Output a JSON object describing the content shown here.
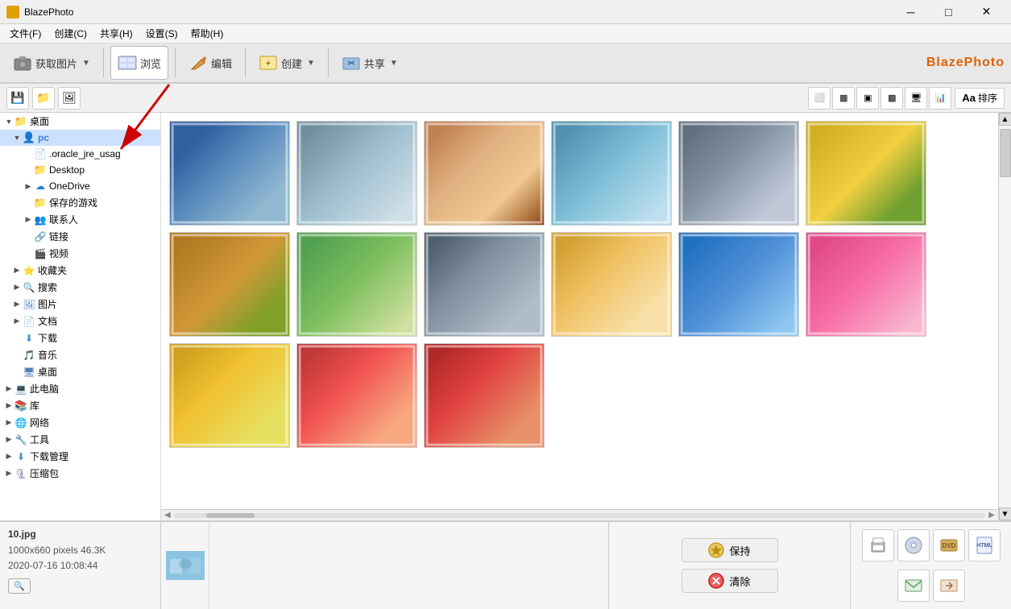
{
  "titleBar": {
    "appName": "BlazePhoto",
    "icon": "🔥",
    "minBtn": "─",
    "maxBtn": "□",
    "closeBtn": "✕"
  },
  "menuBar": {
    "items": [
      "文件(F)",
      "创建(C)",
      "共享(H)",
      "设置(S)",
      "帮助(H)"
    ]
  },
  "toolbar": {
    "groups": [
      {
        "id": "get",
        "icon": "📷",
        "label": "获取图片",
        "hasArrow": true
      },
      {
        "id": "browse",
        "icon": "🖼",
        "label": "浏览",
        "hasArrow": false,
        "active": true
      },
      {
        "id": "edit",
        "icon": "✏️",
        "label": "编辑",
        "hasArrow": false
      },
      {
        "id": "create",
        "icon": "🎨",
        "label": "创建",
        "hasArrow": true
      },
      {
        "id": "share",
        "icon": "📤",
        "label": "共享",
        "hasArrow": true
      }
    ],
    "brand": "BlazePhoto"
  },
  "subToolbar": {
    "buttons": [
      "💾",
      "📁",
      "🖼"
    ],
    "viewButtons": [
      "⬜",
      "▦",
      "▣",
      "▩",
      "🖥",
      "📊"
    ],
    "sortLabel": "排序",
    "textSizeIcon": "Aa"
  },
  "sidebar": {
    "items": [
      {
        "level": 0,
        "toggle": "▼",
        "icon": "folder",
        "label": "桌面",
        "color": "blue"
      },
      {
        "level": 1,
        "toggle": "▼",
        "icon": "folder",
        "label": "pc",
        "color": "blue",
        "selected": true
      },
      {
        "level": 2,
        "toggle": " ",
        "icon": "doc",
        "label": ".oracle_jre_usag",
        "color": "doc"
      },
      {
        "level": 2,
        "toggle": " ",
        "icon": "folder",
        "label": "Desktop",
        "color": "yellow"
      },
      {
        "level": 2,
        "toggle": "▶",
        "icon": "cloud",
        "label": "OneDrive",
        "color": "blue"
      },
      {
        "level": 2,
        "toggle": " ",
        "icon": "game",
        "label": "保存的游戏",
        "color": "yellow"
      },
      {
        "level": 2,
        "toggle": "▶",
        "icon": "contacts",
        "label": "联系人",
        "color": "blue"
      },
      {
        "level": 2,
        "toggle": " ",
        "icon": "link",
        "label": "链接",
        "color": "blue"
      },
      {
        "level": 2,
        "toggle": " ",
        "icon": "video",
        "label": "视频",
        "color": "blue"
      },
      {
        "level": 1,
        "toggle": "▶",
        "icon": "star",
        "label": "收藏夹",
        "color": "yellow"
      },
      {
        "level": 1,
        "toggle": "▶",
        "icon": "search",
        "label": "搜索",
        "color": "blue"
      },
      {
        "level": 1,
        "toggle": "▶",
        "icon": "picture",
        "label": "图片",
        "color": "blue"
      },
      {
        "level": 1,
        "toggle": "▶",
        "icon": "doc",
        "label": "文档",
        "color": "blue"
      },
      {
        "level": 1,
        "toggle": " ",
        "icon": "download",
        "label": "下载",
        "color": "blue"
      },
      {
        "level": 1,
        "toggle": " ",
        "icon": "music",
        "label": "音乐",
        "color": "blue"
      },
      {
        "level": 1,
        "toggle": " ",
        "icon": "desktop",
        "label": "桌面",
        "color": "blue"
      },
      {
        "level": 0,
        "toggle": "▶",
        "icon": "computer",
        "label": "此电脑",
        "color": "blue"
      },
      {
        "level": 0,
        "toggle": "▶",
        "icon": "library",
        "label": "库",
        "color": "blue"
      },
      {
        "level": 0,
        "toggle": "▶",
        "icon": "network",
        "label": "网络",
        "color": "blue"
      },
      {
        "level": 0,
        "toggle": "▶",
        "icon": "tools",
        "label": "工具",
        "color": "blue"
      },
      {
        "level": 0,
        "toggle": "▶",
        "icon": "download",
        "label": "下载管理",
        "color": "blue"
      },
      {
        "level": 0,
        "toggle": "▶",
        "icon": "zip",
        "label": "压缩包",
        "color": "blue"
      }
    ]
  },
  "photos": [
    {
      "id": 1,
      "colorClass": "p1",
      "hasArrow": false
    },
    {
      "id": 2,
      "colorClass": "p2",
      "hasArrow": false
    },
    {
      "id": 3,
      "colorClass": "p3",
      "hasArrow": false
    },
    {
      "id": 4,
      "colorClass": "p4",
      "hasArrow": false
    },
    {
      "id": 5,
      "colorClass": "p5",
      "hasArrow": false
    },
    {
      "id": 6,
      "colorClass": "p6",
      "hasArrow": false
    },
    {
      "id": 7,
      "colorClass": "p7",
      "hasArrow": false
    },
    {
      "id": 8,
      "colorClass": "p8",
      "hasArrow": false
    },
    {
      "id": 9,
      "colorClass": "p9",
      "hasArrow": false
    },
    {
      "id": 10,
      "colorClass": "p10",
      "hasArrow": false
    },
    {
      "id": 11,
      "colorClass": "p11",
      "hasArrow": false
    },
    {
      "id": 12,
      "colorClass": "p12",
      "hasArrow": false
    },
    {
      "id": 13,
      "colorClass": "p13",
      "hasArrow": false
    },
    {
      "id": 14,
      "colorClass": "p14",
      "hasArrow": false
    },
    {
      "id": 15,
      "colorClass": "p15",
      "hasArrow": false
    }
  ],
  "bottomInfo": {
    "filename": "10.jpg",
    "dimensions": "1000x660 pixels  46.3K",
    "date": "2020-07-16  10:08:44"
  },
  "bottomActions": {
    "keepLabel": "保持",
    "clearLabel": "清除"
  }
}
